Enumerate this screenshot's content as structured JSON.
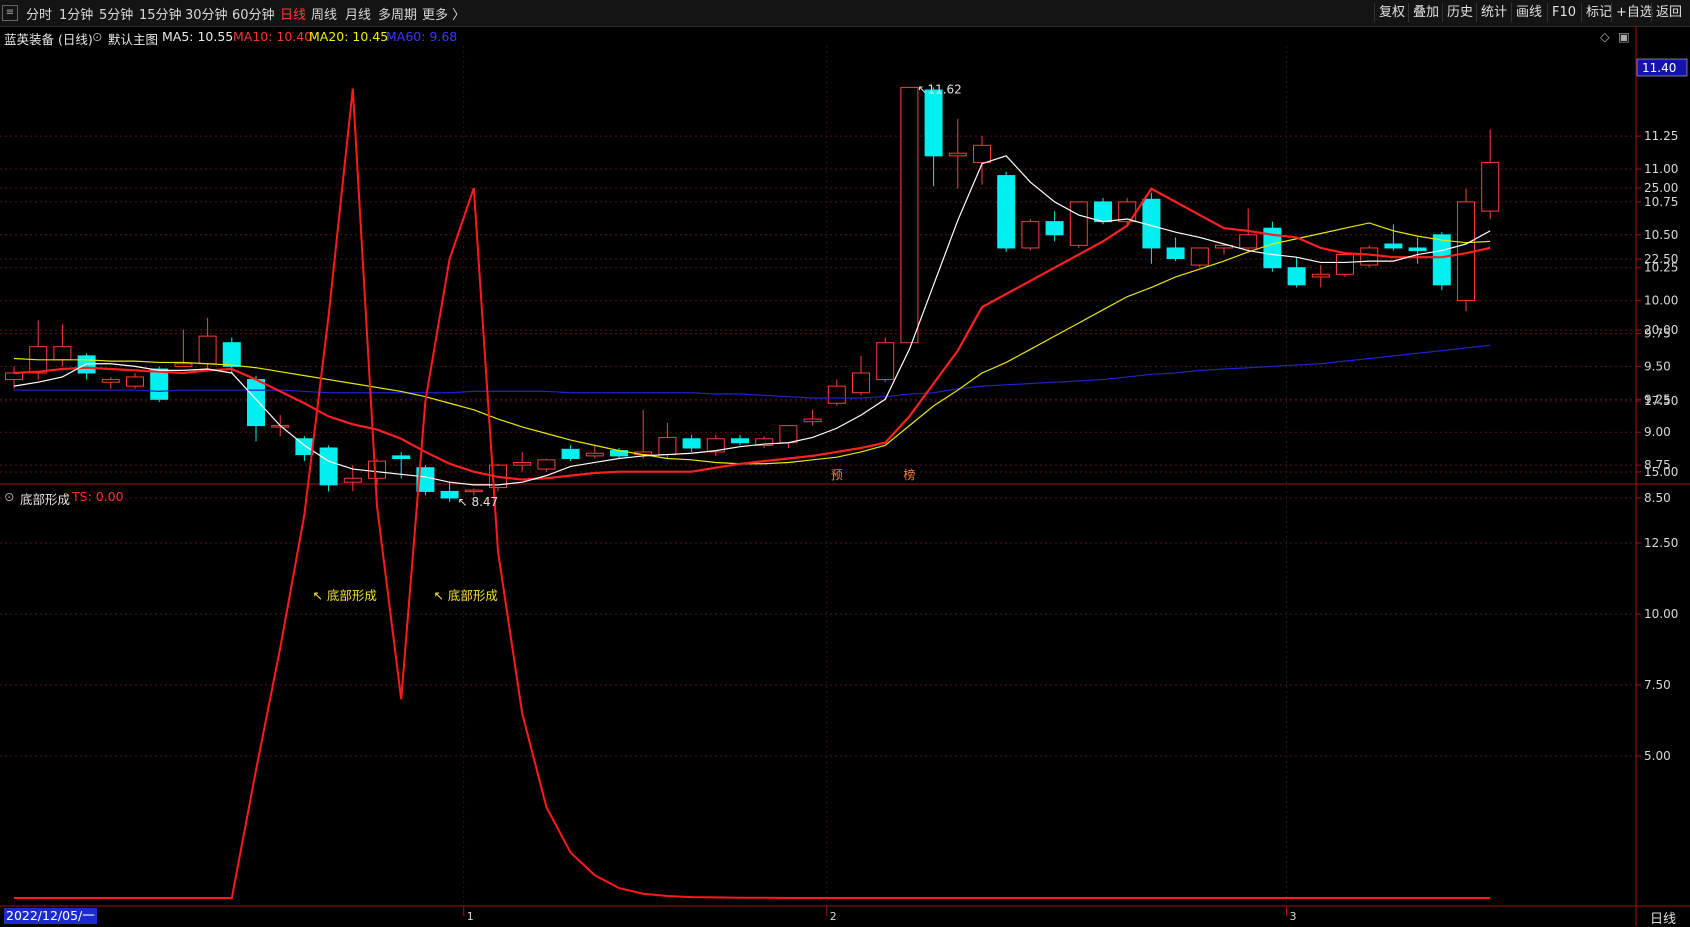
{
  "toolbar": {
    "menu_icon": "menu-icon",
    "periods": [
      "分时",
      "1分钟",
      "5分钟",
      "15分钟",
      "30分钟",
      "60分钟",
      "日线",
      "周线",
      "月线",
      "多周期",
      "更多 〉"
    ],
    "active_period": "日线",
    "right_buttons": [
      "复权",
      "叠加",
      "历史",
      "统计",
      "画线",
      "F10",
      "标记",
      "+自选",
      "返回"
    ]
  },
  "infobar": {
    "stock": "蓝英装备 (日线)",
    "template": "默认主图",
    "ma5": "MA5: 10.55",
    "ma10": "MA10: 10.40",
    "ma20": "MA20: 10.45",
    "ma60": "MA60: 9.68"
  },
  "indicator_bar": {
    "name": "底部形成",
    "ts": "TS: 0.00"
  },
  "footer": {
    "date": "2022/12/05/一",
    "period": "日线",
    "month_marks": [
      "1",
      "2",
      "3"
    ]
  },
  "colors": {
    "up": "#ff3b3b",
    "down": "#00f0f0",
    "ma5": "#ffffff",
    "ma10": "#ff2020",
    "ma20": "#e8e800",
    "ma60": "#2020d0",
    "indicator": "#ff1a1a",
    "annotation": "#f0e030"
  },
  "chart_data": [
    {
      "type": "candlestick",
      "title": "蓝英装备 (日线)",
      "ylim": [
        8.45,
        11.62
      ],
      "yticks": [
        "8.50",
        "8.75",
        "9.00",
        "9.25",
        "9.50",
        "9.75",
        "10.00",
        "10.25",
        "10.50",
        "10.75",
        "11.00",
        "11.25"
      ],
      "last_price_label": "11.40",
      "high_label": "11.62",
      "low_label": "8.47",
      "markers": [
        "预",
        "榜"
      ],
      "candles": [
        {
          "o": 9.4,
          "h": 9.5,
          "l": 9.33,
          "c": 9.45
        },
        {
          "o": 9.45,
          "h": 9.85,
          "l": 9.4,
          "c": 9.65
        },
        {
          "o": 9.55,
          "h": 9.82,
          "l": 9.5,
          "c": 9.65
        },
        {
          "o": 9.58,
          "h": 9.6,
          "l": 9.4,
          "c": 9.45
        },
        {
          "o": 9.38,
          "h": 9.42,
          "l": 9.33,
          "c": 9.4
        },
        {
          "o": 9.35,
          "h": 9.45,
          "l": 9.33,
          "c": 9.42
        },
        {
          "o": 9.48,
          "h": 9.5,
          "l": 9.23,
          "c": 9.25
        },
        {
          "o": 9.5,
          "h": 9.78,
          "l": 9.5,
          "c": 9.52
        },
        {
          "o": 9.52,
          "h": 9.87,
          "l": 9.46,
          "c": 9.73
        },
        {
          "o": 9.68,
          "h": 9.72,
          "l": 9.45,
          "c": 9.5
        },
        {
          "o": 9.4,
          "h": 9.43,
          "l": 8.93,
          "c": 9.05
        },
        {
          "o": 9.05,
          "h": 9.13,
          "l": 8.97,
          "c": 9.05
        },
        {
          "o": 8.95,
          "h": 8.97,
          "l": 8.78,
          "c": 8.83
        },
        {
          "o": 8.88,
          "h": 8.9,
          "l": 8.55,
          "c": 8.6
        },
        {
          "o": 8.62,
          "h": 8.75,
          "l": 8.55,
          "c": 8.65
        },
        {
          "o": 8.65,
          "h": 8.8,
          "l": 8.6,
          "c": 8.78
        },
        {
          "o": 8.82,
          "h": 8.85,
          "l": 8.65,
          "c": 8.8
        },
        {
          "o": 8.73,
          "h": 8.75,
          "l": 8.52,
          "c": 8.55
        },
        {
          "o": 8.55,
          "h": 8.62,
          "l": 8.47,
          "c": 8.5
        },
        {
          "o": 8.55,
          "h": 8.57,
          "l": 8.52,
          "c": 8.56
        },
        {
          "o": 8.58,
          "h": 8.76,
          "l": 8.55,
          "c": 8.75
        },
        {
          "o": 8.75,
          "h": 8.85,
          "l": 8.7,
          "c": 8.77
        },
        {
          "o": 8.72,
          "h": 8.8,
          "l": 8.7,
          "c": 8.79
        },
        {
          "o": 8.87,
          "h": 8.9,
          "l": 8.78,
          "c": 8.8
        },
        {
          "o": 8.82,
          "h": 8.9,
          "l": 8.8,
          "c": 8.84
        },
        {
          "o": 8.86,
          "h": 8.88,
          "l": 8.8,
          "c": 8.82
        },
        {
          "o": 8.83,
          "h": 9.17,
          "l": 8.8,
          "c": 8.85
        },
        {
          "o": 8.83,
          "h": 9.07,
          "l": 8.8,
          "c": 8.96
        },
        {
          "o": 8.95,
          "h": 8.98,
          "l": 8.85,
          "c": 8.88
        },
        {
          "o": 8.85,
          "h": 8.98,
          "l": 8.82,
          "c": 8.95
        },
        {
          "o": 8.95,
          "h": 8.98,
          "l": 8.9,
          "c": 8.92
        },
        {
          "o": 8.9,
          "h": 8.97,
          "l": 8.88,
          "c": 8.95
        },
        {
          "o": 8.92,
          "h": 9.05,
          "l": 8.88,
          "c": 9.05
        },
        {
          "o": 9.08,
          "h": 9.17,
          "l": 9.05,
          "c": 9.1
        },
        {
          "o": 9.22,
          "h": 9.4,
          "l": 9.2,
          "c": 9.35
        },
        {
          "o": 9.3,
          "h": 9.58,
          "l": 9.28,
          "c": 9.45
        },
        {
          "o": 9.4,
          "h": 9.72,
          "l": 9.38,
          "c": 9.68
        },
        {
          "o": 9.68,
          "h": 11.62,
          "l": 9.68,
          "c": 11.62
        },
        {
          "o": 11.6,
          "h": 11.62,
          "l": 10.87,
          "c": 11.1
        },
        {
          "o": 11.1,
          "h": 11.38,
          "l": 10.85,
          "c": 11.12
        },
        {
          "o": 11.05,
          "h": 11.25,
          "l": 10.88,
          "c": 11.18
        },
        {
          "o": 10.95,
          "h": 10.98,
          "l": 10.37,
          "c": 10.4
        },
        {
          "o": 10.4,
          "h": 10.62,
          "l": 10.38,
          "c": 10.6
        },
        {
          "o": 10.6,
          "h": 10.68,
          "l": 10.45,
          "c": 10.5
        },
        {
          "o": 10.42,
          "h": 10.75,
          "l": 10.4,
          "c": 10.75
        },
        {
          "o": 10.75,
          "h": 10.78,
          "l": 10.58,
          "c": 10.6
        },
        {
          "o": 10.6,
          "h": 10.78,
          "l": 10.57,
          "c": 10.75
        },
        {
          "o": 10.77,
          "h": 10.82,
          "l": 10.28,
          "c": 10.4
        },
        {
          "o": 10.4,
          "h": 10.48,
          "l": 10.3,
          "c": 10.32
        },
        {
          "o": 10.27,
          "h": 10.4,
          "l": 10.25,
          "c": 10.4
        },
        {
          "o": 10.4,
          "h": 10.43,
          "l": 10.35,
          "c": 10.42
        },
        {
          "o": 10.4,
          "h": 10.7,
          "l": 10.38,
          "c": 10.5
        },
        {
          "o": 10.55,
          "h": 10.6,
          "l": 10.22,
          "c": 10.25
        },
        {
          "o": 10.25,
          "h": 10.33,
          "l": 10.1,
          "c": 10.12
        },
        {
          "o": 10.18,
          "h": 10.27,
          "l": 10.1,
          "c": 10.2
        },
        {
          "o": 10.2,
          "h": 10.37,
          "l": 10.18,
          "c": 10.35
        },
        {
          "o": 10.27,
          "h": 10.42,
          "l": 10.25,
          "c": 10.4
        },
        {
          "o": 10.43,
          "h": 10.58,
          "l": 10.38,
          "c": 10.4
        },
        {
          "o": 10.4,
          "h": 10.48,
          "l": 10.28,
          "c": 10.38
        },
        {
          "o": 10.5,
          "h": 10.52,
          "l": 10.08,
          "c": 10.12
        },
        {
          "o": 10.0,
          "h": 10.85,
          "l": 9.92,
          "c": 10.75
        },
        {
          "o": 10.68,
          "h": 11.3,
          "l": 10.62,
          "c": 11.05
        }
      ],
      "ma5": [
        9.35,
        9.38,
        9.42,
        9.52,
        9.52,
        9.5,
        9.47,
        9.47,
        9.48,
        9.45,
        9.25,
        9.05,
        8.9,
        8.78,
        8.72,
        8.7,
        8.68,
        8.66,
        8.62,
        8.6,
        8.6,
        8.62,
        8.67,
        8.74,
        8.77,
        8.8,
        8.82,
        8.83,
        8.84,
        8.86,
        8.89,
        8.91,
        8.92,
        8.96,
        9.03,
        9.13,
        9.25,
        9.63,
        10.12,
        10.61,
        11.04,
        11.1,
        10.9,
        10.75,
        10.65,
        10.6,
        10.62,
        10.57,
        10.52,
        10.48,
        10.43,
        10.38,
        10.35,
        10.33,
        10.29,
        10.29,
        10.3,
        10.3,
        10.35,
        10.38,
        10.43,
        10.53
      ],
      "ma10": [
        9.45,
        9.46,
        9.48,
        9.49,
        9.48,
        9.47,
        9.46,
        9.45,
        9.47,
        9.48,
        9.4,
        9.31,
        9.22,
        9.12,
        9.06,
        9.02,
        8.95,
        8.85,
        8.76,
        8.7,
        8.66,
        8.64,
        8.65,
        8.67,
        8.69,
        8.7,
        8.7,
        8.7,
        8.7,
        8.73,
        8.76,
        8.78,
        8.8,
        8.82,
        8.85,
        8.88,
        8.92,
        9.12,
        9.37,
        9.62,
        9.95,
        10.05,
        10.15,
        10.25,
        10.35,
        10.45,
        10.57,
        10.85,
        10.75,
        10.65,
        10.55,
        10.53,
        10.5,
        10.48,
        10.4,
        10.36,
        10.35,
        10.33,
        10.33,
        10.33,
        10.36,
        10.4
      ],
      "ma20": [
        9.56,
        9.55,
        9.55,
        9.55,
        9.54,
        9.54,
        9.53,
        9.53,
        9.52,
        9.51,
        9.49,
        9.46,
        9.43,
        9.4,
        9.37,
        9.34,
        9.31,
        9.27,
        9.22,
        9.17,
        9.1,
        9.04,
        8.99,
        8.94,
        8.9,
        8.86,
        8.83,
        8.8,
        8.79,
        8.77,
        8.76,
        8.76,
        8.77,
        8.79,
        8.81,
        8.85,
        8.9,
        9.05,
        9.2,
        9.32,
        9.45,
        9.53,
        9.63,
        9.73,
        9.83,
        9.93,
        10.03,
        10.1,
        10.18,
        10.24,
        10.3,
        10.37,
        10.43,
        10.47,
        10.51,
        10.55,
        10.59,
        10.53,
        10.49,
        10.46,
        10.44,
        10.45
      ],
      "ma60": [
        9.32,
        9.32,
        9.32,
        9.32,
        9.32,
        9.32,
        9.31,
        9.32,
        9.32,
        9.32,
        9.32,
        9.32,
        9.31,
        9.3,
        9.3,
        9.3,
        9.3,
        9.3,
        9.3,
        9.31,
        9.31,
        9.31,
        9.31,
        9.3,
        9.3,
        9.3,
        9.3,
        9.3,
        9.3,
        9.29,
        9.29,
        9.28,
        9.27,
        9.26,
        9.26,
        9.26,
        9.27,
        9.29,
        9.3,
        9.33,
        9.35,
        9.36,
        9.37,
        9.38,
        9.39,
        9.4,
        9.42,
        9.44,
        9.45,
        9.47,
        9.48,
        9.49,
        9.5,
        9.51,
        9.52,
        9.54,
        9.56,
        9.58,
        9.6,
        9.62,
        9.64,
        9.66
      ]
    },
    {
      "type": "line",
      "title": "底部形成",
      "ylim": [
        0,
        28
      ],
      "yticks": [
        "5.00",
        "7.50",
        "10.00",
        "12.50",
        "15.00",
        "17.50",
        "20.00",
        "22.50",
        "25.00"
      ],
      "annotation": "底部形成",
      "annotation_points": [
        {
          "x": 12,
          "y": 10.5
        },
        {
          "x": 17,
          "y": 10.5
        }
      ],
      "values": [
        0,
        0,
        0,
        0,
        0,
        0,
        0,
        0,
        0,
        0,
        4.5,
        8.8,
        13.5,
        20.5,
        28.5,
        13.8,
        7.0,
        17.5,
        22.5,
        25.0,
        12.2,
        6.5,
        3.2,
        1.6,
        0.8,
        0.35,
        0.15,
        0.07,
        0.03,
        0.02,
        0.01,
        0.01,
        0,
        0,
        0,
        0,
        0,
        0,
        0,
        0,
        0,
        0,
        0,
        0,
        0,
        0,
        0,
        0,
        0,
        0,
        0,
        0,
        0,
        0,
        0,
        0,
        0,
        0,
        0,
        0,
        0,
        0
      ]
    }
  ]
}
